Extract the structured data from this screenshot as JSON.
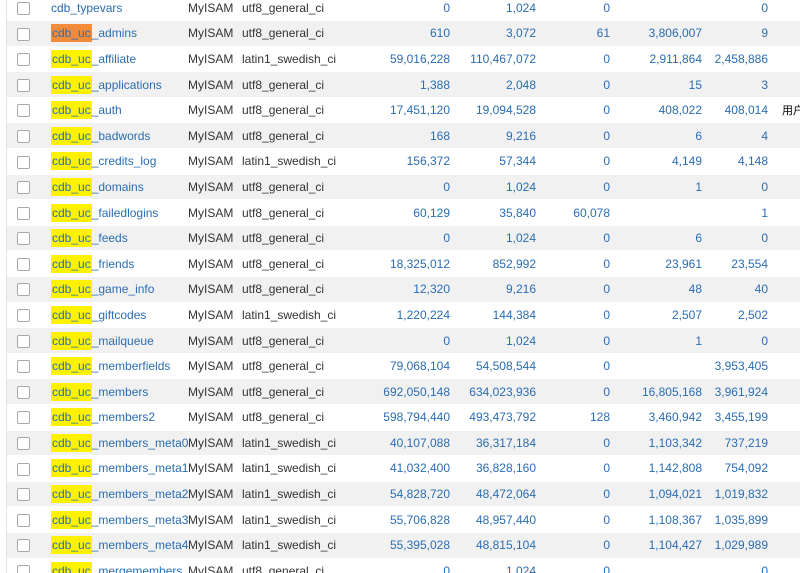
{
  "rows": [
    {
      "prefix": "",
      "suffix": "cdb_typevars",
      "highlight": "none",
      "engine": "MyISAM",
      "collation": "utf8_general_ci",
      "rows": "0",
      "data": "1,024",
      "overhead": "0",
      "index": "",
      "auto_inc": "0",
      "comment": ""
    },
    {
      "prefix": "cdb_uc",
      "suffix": "_admins",
      "highlight": "orange",
      "engine": "MyISAM",
      "collation": "utf8_general_ci",
      "rows": "610",
      "data": "3,072",
      "overhead": "61",
      "index": "3,806,007",
      "auto_inc": "9",
      "comment": ""
    },
    {
      "prefix": "cdb_uc",
      "suffix": "_affiliate",
      "highlight": "yellow",
      "engine": "MyISAM",
      "collation": "latin1_swedish_ci",
      "rows": "59,016,228",
      "data": "110,467,072",
      "overhead": "0",
      "index": "2,911,864",
      "auto_inc": "2,458,886",
      "comment": ""
    },
    {
      "prefix": "cdb_uc",
      "suffix": "_applications",
      "highlight": "yellow",
      "engine": "MyISAM",
      "collation": "utf8_general_ci",
      "rows": "1,388",
      "data": "2,048",
      "overhead": "0",
      "index": "15",
      "auto_inc": "3",
      "comment": ""
    },
    {
      "prefix": "cdb_uc",
      "suffix": "_auth",
      "highlight": "yellow",
      "engine": "MyISAM",
      "collation": "utf8_general_ci",
      "rows": "17,451,120",
      "data": "19,094,528",
      "overhead": "0",
      "index": "408,022",
      "auto_inc": "408,014",
      "comment": "用户认证"
    },
    {
      "prefix": "cdb_uc",
      "suffix": "_badwords",
      "highlight": "yellow",
      "engine": "MyISAM",
      "collation": "utf8_general_ci",
      "rows": "168",
      "data": "9,216",
      "overhead": "0",
      "index": "6",
      "auto_inc": "4",
      "comment": ""
    },
    {
      "prefix": "cdb_uc",
      "suffix": "_credits_log",
      "highlight": "yellow",
      "engine": "MyISAM",
      "collation": "latin1_swedish_ci",
      "rows": "156,372",
      "data": "57,344",
      "overhead": "0",
      "index": "4,149",
      "auto_inc": "4,148",
      "comment": ""
    },
    {
      "prefix": "cdb_uc",
      "suffix": "_domains",
      "highlight": "yellow",
      "engine": "MyISAM",
      "collation": "utf8_general_ci",
      "rows": "0",
      "data": "1,024",
      "overhead": "0",
      "index": "1",
      "auto_inc": "0",
      "comment": ""
    },
    {
      "prefix": "cdb_uc",
      "suffix": "_failedlogins",
      "highlight": "yellow",
      "engine": "MyISAM",
      "collation": "utf8_general_ci",
      "rows": "60,129",
      "data": "35,840",
      "overhead": "60,078",
      "index": "",
      "auto_inc": "1",
      "comment": ""
    },
    {
      "prefix": "cdb_uc",
      "suffix": "_feeds",
      "highlight": "yellow",
      "engine": "MyISAM",
      "collation": "utf8_general_ci",
      "rows": "0",
      "data": "1,024",
      "overhead": "0",
      "index": "6",
      "auto_inc": "0",
      "comment": ""
    },
    {
      "prefix": "cdb_uc",
      "suffix": "_friends",
      "highlight": "yellow",
      "engine": "MyISAM",
      "collation": "utf8_general_ci",
      "rows": "18,325,012",
      "data": "852,992",
      "overhead": "0",
      "index": "23,961",
      "auto_inc": "23,554",
      "comment": ""
    },
    {
      "prefix": "cdb_uc",
      "suffix": "_game_info",
      "highlight": "yellow",
      "engine": "MyISAM",
      "collation": "utf8_general_ci",
      "rows": "12,320",
      "data": "9,216",
      "overhead": "0",
      "index": "48",
      "auto_inc": "40",
      "comment": ""
    },
    {
      "prefix": "cdb_uc",
      "suffix": "_giftcodes",
      "highlight": "yellow",
      "engine": "MyISAM",
      "collation": "latin1_swedish_ci",
      "rows": "1,220,224",
      "data": "144,384",
      "overhead": "0",
      "index": "2,507",
      "auto_inc": "2,502",
      "comment": ""
    },
    {
      "prefix": "cdb_uc",
      "suffix": "_mailqueue",
      "highlight": "yellow",
      "engine": "MyISAM",
      "collation": "utf8_general_ci",
      "rows": "0",
      "data": "1,024",
      "overhead": "0",
      "index": "1",
      "auto_inc": "0",
      "comment": ""
    },
    {
      "prefix": "cdb_uc",
      "suffix": "_memberfields",
      "highlight": "yellow",
      "engine": "MyISAM",
      "collation": "utf8_general_ci",
      "rows": "79,068,104",
      "data": "54,508,544",
      "overhead": "0",
      "index": "",
      "auto_inc": "3,953,405",
      "comment": ""
    },
    {
      "prefix": "cdb_uc",
      "suffix": "_members",
      "highlight": "yellow",
      "engine": "MyISAM",
      "collation": "utf8_general_ci",
      "rows": "692,050,148",
      "data": "634,023,936",
      "overhead": "0",
      "index": "16,805,168",
      "auto_inc": "3,961,924",
      "comment": ""
    },
    {
      "prefix": "cdb_uc",
      "suffix": "_members2",
      "highlight": "yellow",
      "engine": "MyISAM",
      "collation": "utf8_general_ci",
      "rows": "598,794,440",
      "data": "493,473,792",
      "overhead": "128",
      "index": "3,460,942",
      "auto_inc": "3,455,199",
      "comment": ""
    },
    {
      "prefix": "cdb_uc",
      "suffix": "_members_meta0",
      "highlight": "yellow",
      "engine": "MyISAM",
      "collation": "latin1_swedish_ci",
      "rows": "40,107,088",
      "data": "36,317,184",
      "overhead": "0",
      "index": "1,103,342",
      "auto_inc": "737,219",
      "comment": ""
    },
    {
      "prefix": "cdb_uc",
      "suffix": "_members_meta1",
      "highlight": "yellow",
      "engine": "MyISAM",
      "collation": "latin1_swedish_ci",
      "rows": "41,032,400",
      "data": "36,828,160",
      "overhead": "0",
      "index": "1,142,808",
      "auto_inc": "754,092",
      "comment": ""
    },
    {
      "prefix": "cdb_uc",
      "suffix": "_members_meta2",
      "highlight": "yellow",
      "engine": "MyISAM",
      "collation": "latin1_swedish_ci",
      "rows": "54,828,720",
      "data": "48,472,064",
      "overhead": "0",
      "index": "1,094,021",
      "auto_inc": "1,019,832",
      "comment": ""
    },
    {
      "prefix": "cdb_uc",
      "suffix": "_members_meta3",
      "highlight": "yellow",
      "engine": "MyISAM",
      "collation": "latin1_swedish_ci",
      "rows": "55,706,828",
      "data": "48,957,440",
      "overhead": "0",
      "index": "1,108,367",
      "auto_inc": "1,035,899",
      "comment": ""
    },
    {
      "prefix": "cdb_uc",
      "suffix": "_members_meta4",
      "highlight": "yellow",
      "engine": "MyISAM",
      "collation": "latin1_swedish_ci",
      "rows": "55,395,028",
      "data": "48,815,104",
      "overhead": "0",
      "index": "1,104,427",
      "auto_inc": "1,029,989",
      "comment": ""
    },
    {
      "prefix": "cdb_uc",
      "suffix": "_mergemembers",
      "highlight": "yellow",
      "engine": "MyISAM",
      "collation": "utf8_general_ci",
      "rows": "0",
      "data": "1,024",
      "overhead": "0",
      "index": "",
      "auto_inc": "0",
      "comment": ""
    }
  ]
}
